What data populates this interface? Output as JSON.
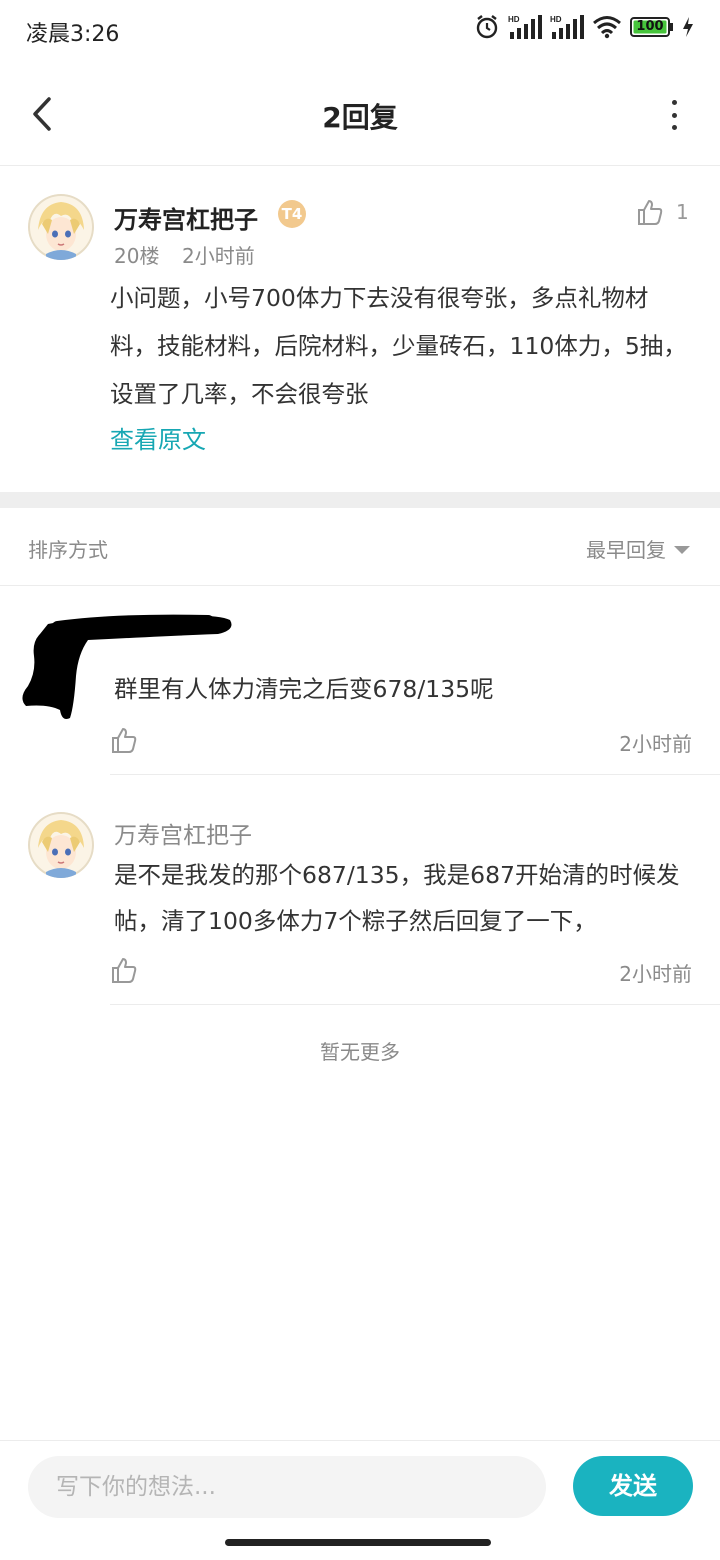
{
  "status_bar": {
    "time": "凌晨3:26",
    "battery": "100",
    "icons": [
      "alarm-icon",
      "signal-hd-icon",
      "signal-hd-icon",
      "wifi-icon",
      "battery-icon",
      "charging-icon"
    ]
  },
  "header": {
    "title": "2回复",
    "back_icon": "chevron-left-icon",
    "more_icon": "more-vertical-icon"
  },
  "post": {
    "author": "万寿宫杠把子",
    "level_badge": "T4",
    "floor": "20楼",
    "time": "2小时前",
    "like_count": "1",
    "content": "小问题，小号700体力下去没有很夸张，多点礼物材料，技能材料，后院材料，少量砖石，110体力，5抽，设置了几率，不会很夸张",
    "view_original": "查看原文"
  },
  "sort": {
    "label": "排序方式",
    "selected": "最早回复"
  },
  "replies": [
    {
      "author": "",
      "text": "群里有人体力清完之后变678/135呢",
      "time": "2小时前"
    },
    {
      "author": "万寿宫杠把子",
      "text": "是不是我发的那个687/135，我是687开始清的时候发帖，清了100多体力7个粽子然后回复了一下，",
      "time": "2小时前"
    }
  ],
  "no_more": "暂无更多",
  "composer": {
    "placeholder": "写下你的想法...",
    "send_label": "发送"
  },
  "colors": {
    "accent": "#1ab3c0",
    "link": "#17a7b3",
    "badge": "#f2c98e",
    "divider": "#eeeeee"
  }
}
